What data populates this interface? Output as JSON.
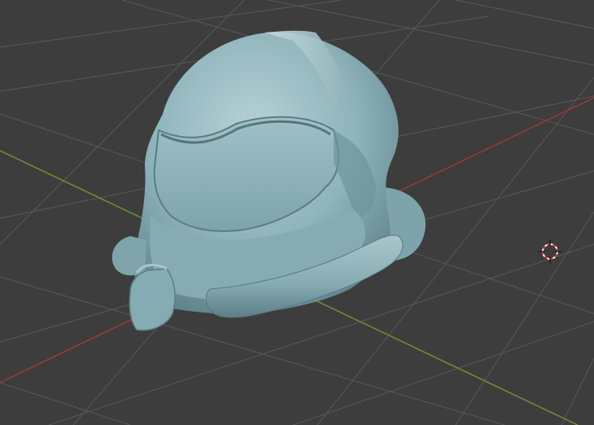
{
  "viewport": {
    "background": "#3d3d3d",
    "grid_color": "#5a5a5a",
    "x_axis_color": "#9a3a3a",
    "y_axis_color": "#6e8f34"
  },
  "model": {
    "object": "helmet",
    "material_color": "#8fb4bc",
    "shading": "solid"
  },
  "cursor": {
    "icon": "3d-cursor-icon",
    "colors": [
      "#d23b3b",
      "#ffffff"
    ]
  }
}
